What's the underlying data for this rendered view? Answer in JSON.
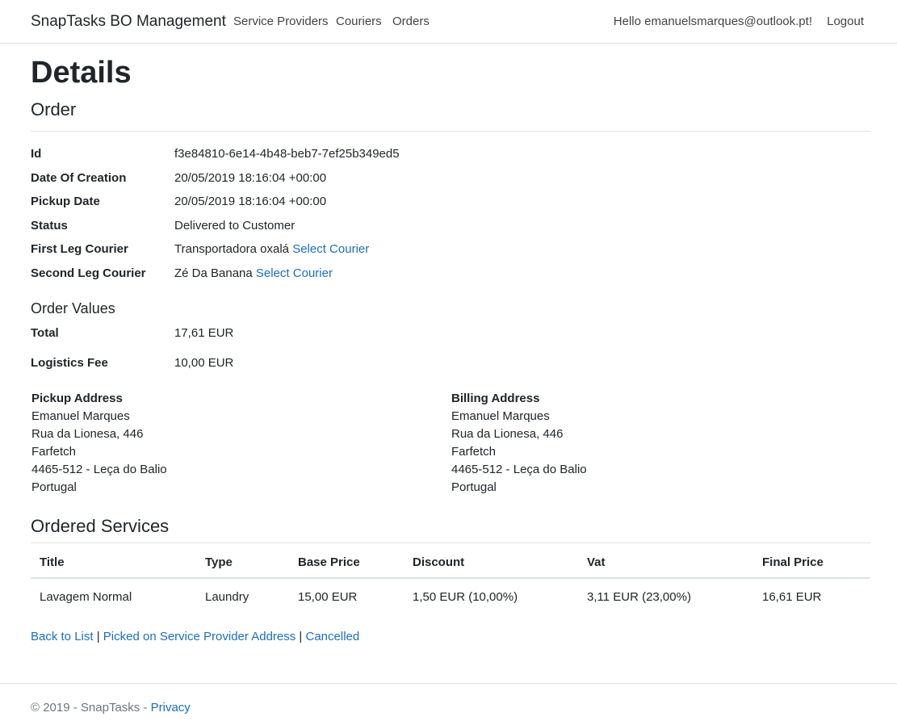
{
  "nav": {
    "brand": "SnapTasks BO Management",
    "links": [
      "Service Providers",
      "Couriers",
      "Orders"
    ],
    "hello": "Hello emanuelsmarques@outlook.pt!",
    "logout": "Logout"
  },
  "page": {
    "title": "Details",
    "subtitle": "Order"
  },
  "order": {
    "fields": [
      {
        "label": "Id",
        "value": "f3e84810-6e14-4b48-beb7-7ef25b349ed5"
      },
      {
        "label": "Date Of Creation",
        "value": "20/05/2019 18:16:04 +00:00"
      },
      {
        "label": "Pickup Date",
        "value": "20/05/2019 18:16:04 +00:00"
      },
      {
        "label": "Status",
        "value": "Delivered to Customer"
      },
      {
        "label": "First Leg Courier",
        "value": "Transportadora oxalá",
        "link": "Select Courier"
      },
      {
        "label": "Second Leg Courier",
        "value": "Zé Da Banana",
        "link": "Select Courier"
      }
    ]
  },
  "values": {
    "heading": "Order Values",
    "total_label": "Total",
    "total_value": "17,61 EUR",
    "fee_label": "Logistics Fee",
    "fee_value": "10,00 EUR"
  },
  "pickup_address": {
    "title": "Pickup Address",
    "lines": [
      "Emanuel Marques",
      "Rua da Lionesa, 446",
      "Farfetch",
      "4465-512 - Leça do Balio",
      "Portugal"
    ]
  },
  "billing_address": {
    "title": "Billing Address",
    "lines": [
      "Emanuel Marques",
      "Rua da Lionesa, 446",
      "Farfetch",
      "4465-512 - Leça do Balio",
      "Portugal"
    ]
  },
  "services": {
    "heading": "Ordered Services",
    "columns": [
      "Title",
      "Type",
      "Base Price",
      "Discount",
      "Vat",
      "Final Price"
    ],
    "rows": [
      [
        "Lavagem Normal",
        "Laundry",
        "15,00 EUR",
        "1,50 EUR (10,00%)",
        "3,11 EUR (23,00%)",
        "16,61 EUR"
      ]
    ]
  },
  "actions": {
    "back": "Back to List",
    "picked": "Picked on Service Provider Address",
    "cancelled": "Cancelled",
    "separator": "|"
  },
  "footer": {
    "text": "© 2019 - SnapTasks - ",
    "privacy": "Privacy"
  },
  "colors": {
    "link": "#1b6ec2",
    "border": "#dee2e6"
  }
}
